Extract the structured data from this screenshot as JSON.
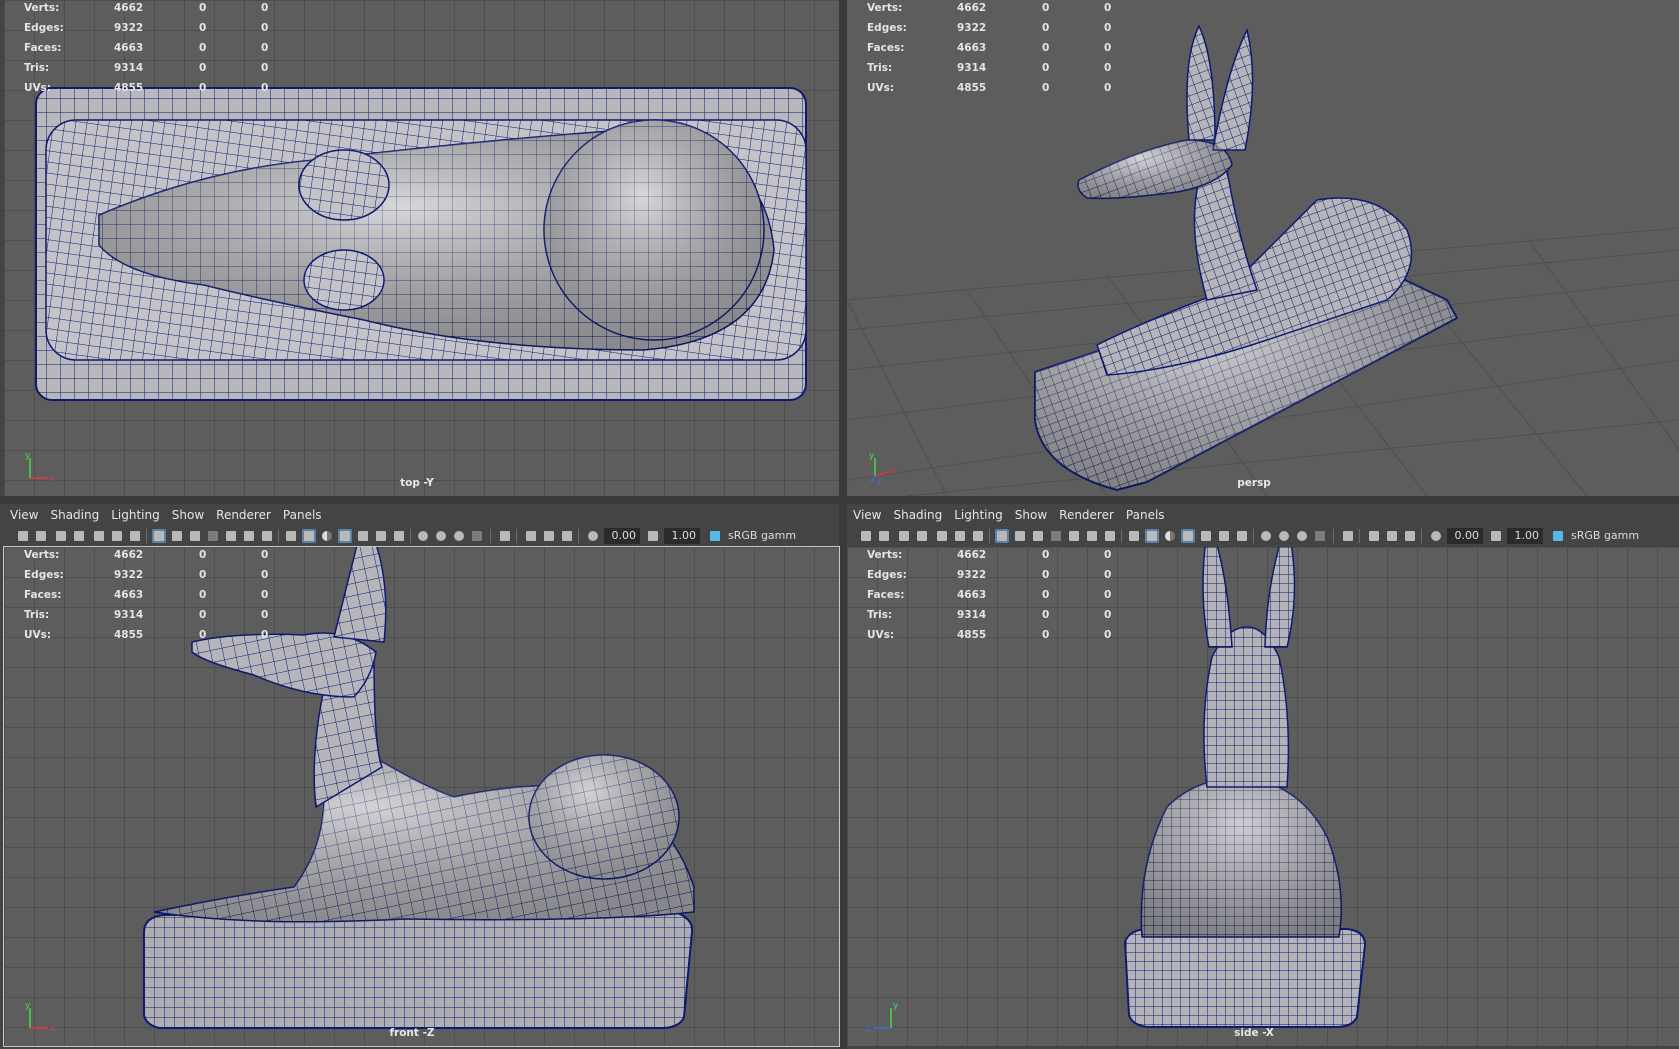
{
  "menu": [
    "View",
    "Shading",
    "Lighting",
    "Show",
    "Renderer",
    "Panels"
  ],
  "toolbar": {
    "near_value": "0.00",
    "exposure_value": "1.00",
    "color_space": "sRGB gamm"
  },
  "hud": {
    "rows": [
      {
        "label": "Verts:",
        "v1": "4662",
        "v2": "0",
        "v3": "0"
      },
      {
        "label": "Edges:",
        "v1": "9322",
        "v2": "0",
        "v3": "0"
      },
      {
        "label": "Faces:",
        "v1": "4663",
        "v2": "0",
        "v3": "0"
      },
      {
        "label": "Tris:",
        "v1": "9314",
        "v2": "0",
        "v3": "0"
      },
      {
        "label": "UVs:",
        "v1": "4855",
        "v2": "0",
        "v3": "0"
      }
    ]
  },
  "panels": {
    "top": {
      "camera": "top -Y"
    },
    "persp": {
      "camera": "persp"
    },
    "front": {
      "camera": "front -Z"
    },
    "side": {
      "camera": "side -X"
    }
  },
  "axis_labels": {
    "x": "x",
    "y": "y",
    "z": "z"
  },
  "colors": {
    "wire": "#0e1a6e",
    "mesh": "#b4b4b8",
    "viewport_bg": "#5d5d5d",
    "highlight": "#5c83a8"
  },
  "icons": {
    "toolbar": [
      "camera-icon",
      "lock-camera-icon",
      "bookmark-icon",
      "image-plane-icon",
      "grid-icon",
      "wireframe-icon",
      "smooth-shade-icon",
      "textured-icon",
      "lights-icon",
      "shadows-icon",
      "isolate-icon",
      "xray-icon",
      "exposure-icon",
      "gamma-icon",
      "color-management-icon"
    ]
  }
}
